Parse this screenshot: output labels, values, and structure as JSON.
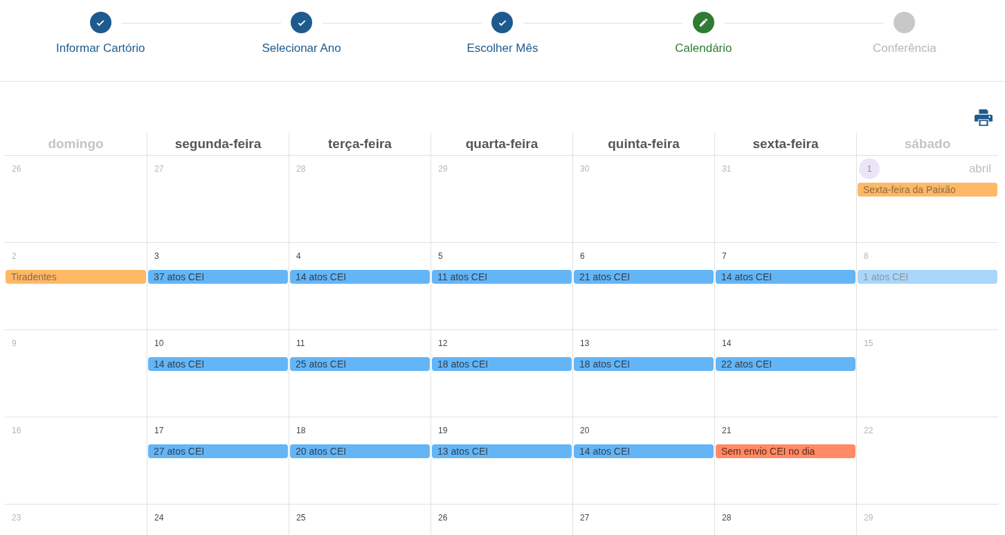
{
  "steps": [
    {
      "label": "Informar Cartório",
      "kind": "done"
    },
    {
      "label": "Selecionar Ano",
      "kind": "done"
    },
    {
      "label": "Escolher Mês",
      "kind": "done"
    },
    {
      "label": "Calendário",
      "kind": "current"
    },
    {
      "label": "Conferência",
      "kind": "pending"
    }
  ],
  "weekdays": [
    {
      "label": "domingo",
      "disabled": true
    },
    {
      "label": "segunda-feira",
      "disabled": false
    },
    {
      "label": "terça-feira",
      "disabled": false
    },
    {
      "label": "quarta-feira",
      "disabled": false
    },
    {
      "label": "quinta-feira",
      "disabled": false
    },
    {
      "label": "sexta-feira",
      "disabled": false
    },
    {
      "label": "sábado",
      "disabled": true
    }
  ],
  "weeks": [
    [
      {
        "number": "26",
        "muted": true
      },
      {
        "number": "27",
        "muted": true
      },
      {
        "number": "28",
        "muted": true
      },
      {
        "number": "29",
        "muted": true
      },
      {
        "number": "30",
        "muted": true
      },
      {
        "number": "31",
        "muted": true
      },
      {
        "number": "1",
        "muted": true,
        "highlighted": true,
        "month_label": "abril",
        "events": [
          {
            "kind": "holiday",
            "text": "Sexta-feira da Paixão",
            "faded": false
          }
        ]
      }
    ],
    [
      {
        "number": "2",
        "muted": true,
        "events": [
          {
            "kind": "holiday",
            "text": "Tiradentes",
            "faded": false
          }
        ]
      },
      {
        "number": "3",
        "muted": false,
        "events": [
          {
            "kind": "count",
            "text": "37 atos CEI",
            "faded": false
          }
        ]
      },
      {
        "number": "4",
        "muted": false,
        "events": [
          {
            "kind": "count",
            "text": "14 atos CEI",
            "faded": false
          }
        ]
      },
      {
        "number": "5",
        "muted": false,
        "events": [
          {
            "kind": "count",
            "text": "11 atos CEI",
            "faded": false
          }
        ]
      },
      {
        "number": "6",
        "muted": false,
        "events": [
          {
            "kind": "count",
            "text": "21 atos CEI",
            "faded": false
          }
        ]
      },
      {
        "number": "7",
        "muted": false,
        "events": [
          {
            "kind": "count",
            "text": "14 atos CEI",
            "faded": false
          }
        ]
      },
      {
        "number": "8",
        "muted": true,
        "events": [
          {
            "kind": "count",
            "text": "1 atos CEI",
            "faded": true
          }
        ]
      }
    ],
    [
      {
        "number": "9",
        "muted": true
      },
      {
        "number": "10",
        "muted": false,
        "events": [
          {
            "kind": "count",
            "text": "14 atos CEI",
            "faded": false
          }
        ]
      },
      {
        "number": "11",
        "muted": false,
        "events": [
          {
            "kind": "count",
            "text": "25 atos CEI",
            "faded": false
          }
        ]
      },
      {
        "number": "12",
        "muted": false,
        "events": [
          {
            "kind": "count",
            "text": "18 atos CEI",
            "faded": false
          }
        ]
      },
      {
        "number": "13",
        "muted": false,
        "events": [
          {
            "kind": "count",
            "text": "18 atos CEI",
            "faded": false
          }
        ]
      },
      {
        "number": "14",
        "muted": false,
        "events": [
          {
            "kind": "count",
            "text": "22 atos CEI",
            "faded": false
          }
        ]
      },
      {
        "number": "15",
        "muted": true
      }
    ],
    [
      {
        "number": "16",
        "muted": true
      },
      {
        "number": "17",
        "muted": false,
        "events": [
          {
            "kind": "count",
            "text": "27 atos CEI",
            "faded": false
          }
        ]
      },
      {
        "number": "18",
        "muted": false,
        "events": [
          {
            "kind": "count",
            "text": "20 atos CEI",
            "faded": false
          }
        ]
      },
      {
        "number": "19",
        "muted": false,
        "events": [
          {
            "kind": "count",
            "text": "13 atos CEI",
            "faded": false
          }
        ]
      },
      {
        "number": "20",
        "muted": false,
        "events": [
          {
            "kind": "count",
            "text": "14 atos CEI",
            "faded": false
          }
        ]
      },
      {
        "number": "21",
        "muted": false,
        "events": [
          {
            "kind": "missing",
            "text": "Sem envio CEI no dia",
            "faded": false
          }
        ]
      },
      {
        "number": "22",
        "muted": true
      }
    ],
    [
      {
        "number": "23",
        "muted": true
      },
      {
        "number": "24",
        "muted": false
      },
      {
        "number": "25",
        "muted": false
      },
      {
        "number": "26",
        "muted": false
      },
      {
        "number": "27",
        "muted": false
      },
      {
        "number": "28",
        "muted": false
      },
      {
        "number": "29",
        "muted": true
      }
    ]
  ]
}
